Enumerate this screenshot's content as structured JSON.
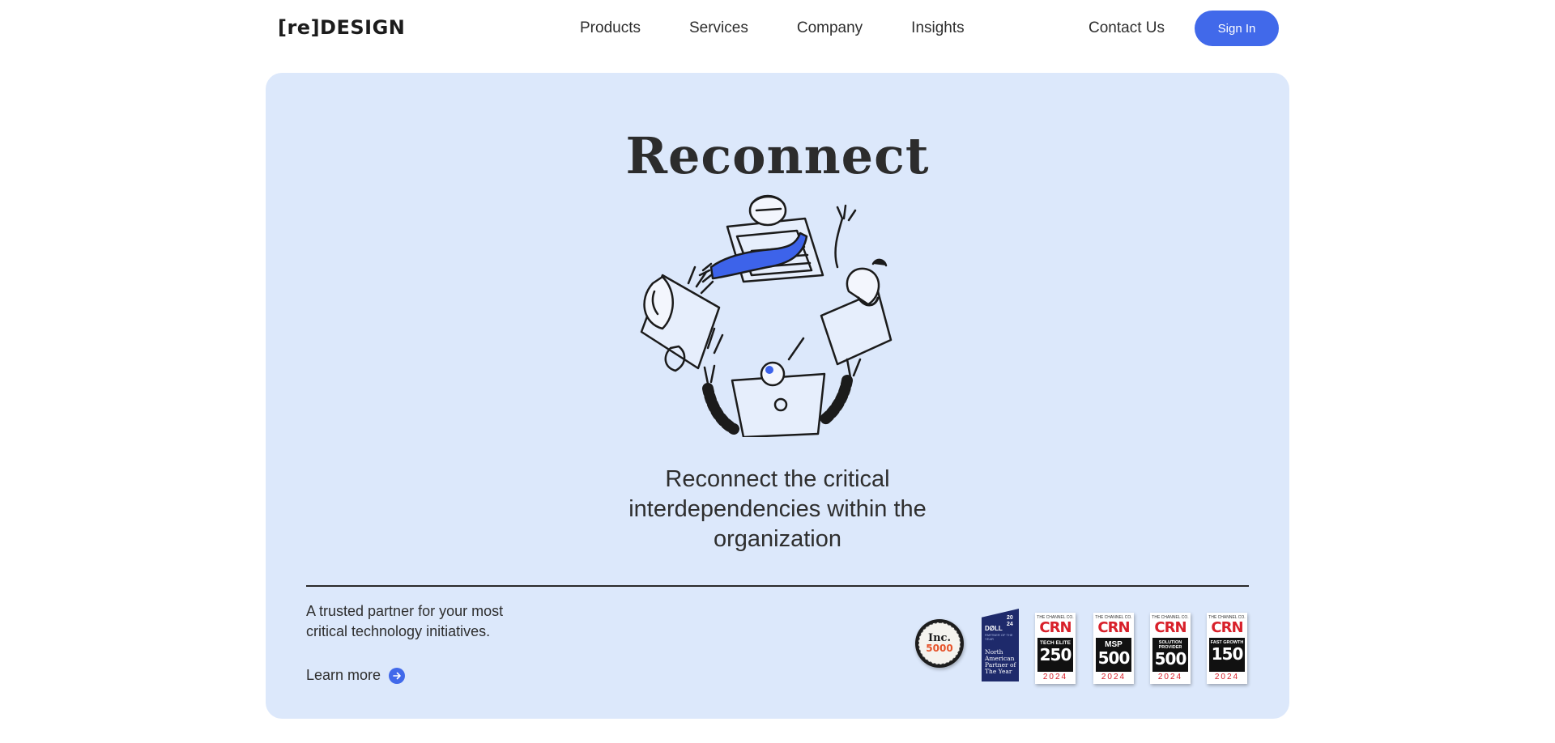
{
  "nav": {
    "logo": "[re]DESIGN",
    "links": [
      "Products",
      "Services",
      "Company",
      "Insights"
    ],
    "contact": "Contact Us",
    "signin": "Sign In"
  },
  "hero": {
    "title": "Reconnect",
    "subtitle": "Reconnect the critical interdependencies within the organization",
    "trusted": "A trusted partner for your most critical technology initiatives.",
    "learn_more": "Learn more"
  },
  "badges": {
    "inc": {
      "word": "Inc.",
      "number": "5000"
    },
    "dell": {
      "logo": "DØLL",
      "year": "20 24",
      "small": "PARTNER OF THE YEAR",
      "text": "North American Partner of The Year"
    },
    "crn": [
      {
        "top": "THE CHANNEL CO.",
        "word": "CRN",
        "label": "TECH ELITE",
        "number": "250",
        "year": "2024"
      },
      {
        "top": "THE CHANNEL CO.",
        "word": "CRN",
        "label": "MSP",
        "number": "500",
        "year": "2024"
      },
      {
        "top": "THE CHANNEL CO.",
        "word": "CRN",
        "label": "SOLUTION PROVIDER",
        "number": "500",
        "year": "2024"
      },
      {
        "top": "THE CHANNEL CO.",
        "word": "CRN",
        "label": "FAST GROWTH",
        "number": "150",
        "year": "2024"
      }
    ]
  },
  "colors": {
    "accent": "#4169ea",
    "hero_bg": "#dce8fb",
    "crn_red": "#d8202a",
    "dell_navy": "#1e2a6b"
  },
  "icons": [
    "arrow-right-icon",
    "team-illustration"
  ]
}
